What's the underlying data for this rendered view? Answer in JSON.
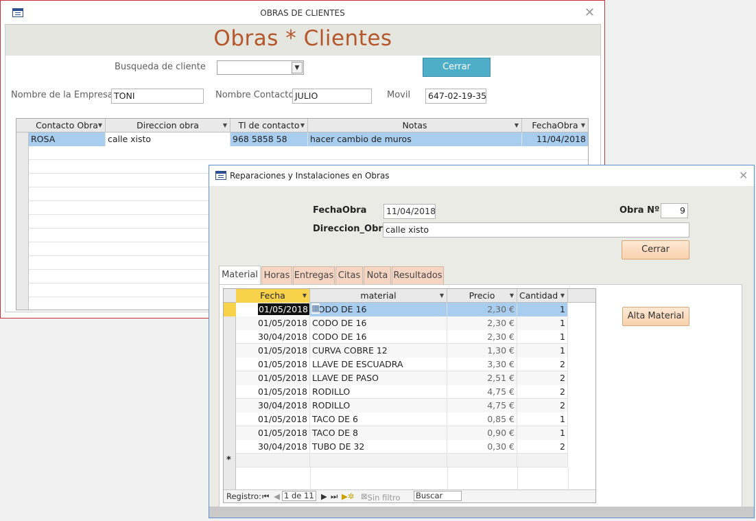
{
  "main_window": {
    "title": "OBRAS DE CLIENTES",
    "heading": "Obras * Clientes",
    "search_label": "Busqueda de cliente",
    "search_value": "",
    "close_button": "Cerrar",
    "fields": {
      "empresa_label": "Nombre de la Empresa",
      "empresa_value": "TONI",
      "contacto_label": "Nombre Contacto",
      "contacto_value": "JULIO",
      "movil_label": "Movil",
      "movil_value": "647-02-19-35"
    },
    "table": {
      "columns": [
        "Contacto Obra",
        "Direccion obra",
        "Tl de contacto",
        "Notas",
        "FechaObra"
      ],
      "rows": [
        [
          "ROSA",
          "calle xisto",
          "968 5858 58",
          "hacer cambio de muros",
          "11/04/2018"
        ]
      ]
    }
  },
  "sub_window": {
    "title": "Reparaciones y Instalaciones en Obras",
    "fecha_label": "FechaObra",
    "fecha_value": "11/04/2018",
    "obra_label": "Obra Nº",
    "obra_value": "9",
    "direccion_label": "Direccion_Obra",
    "direccion_value": "calle xisto",
    "close_button": "Cerrar",
    "alta_button": "Alta Material",
    "tabs": [
      "Material",
      "Horas",
      "Entregas",
      "Citas",
      "Nota",
      "Resultados"
    ],
    "active_tab": "Material",
    "table": {
      "columns": [
        "Fecha",
        "material",
        "Precio",
        "Cantidad"
      ],
      "rows": [
        [
          "01/05/2018",
          "CODO DE 16",
          "2,30 €",
          "1"
        ],
        [
          "01/05/2018",
          "CODO DE 16",
          "2,30 €",
          "1"
        ],
        [
          "30/04/2018",
          "CODO DE 16",
          "2,30 €",
          "1"
        ],
        [
          "01/05/2018",
          "CURVA COBRE 12",
          "1,30 €",
          "1"
        ],
        [
          "01/05/2018",
          "LLAVE DE ESCUADRA",
          "3,30 €",
          "2"
        ],
        [
          "01/05/2018",
          "LLAVE DE PASO",
          "2,51 €",
          "2"
        ],
        [
          "01/05/2018",
          "RODILLO",
          "4,75 €",
          "2"
        ],
        [
          "30/04/2018",
          "RODILLO",
          "4,75 €",
          "2"
        ],
        [
          "01/05/2018",
          "TACO DE  6",
          "0,85 €",
          "1"
        ],
        [
          "01/05/2018",
          "TACO DE 8",
          "0,90 €",
          "1"
        ],
        [
          "30/04/2018",
          "TUBO DE 32",
          "0,30 €",
          "2"
        ]
      ],
      "new_row_marker": "*"
    },
    "navigation": {
      "label": "Registro:",
      "record": "1 de 11",
      "filter": "Sin filtro",
      "search": "Buscar"
    }
  },
  "colors": {
    "heading": "#b5562b",
    "close_button_blue": "#4eaec8",
    "selected_row": "#a8cdee",
    "active_header": "#f9d24c"
  }
}
